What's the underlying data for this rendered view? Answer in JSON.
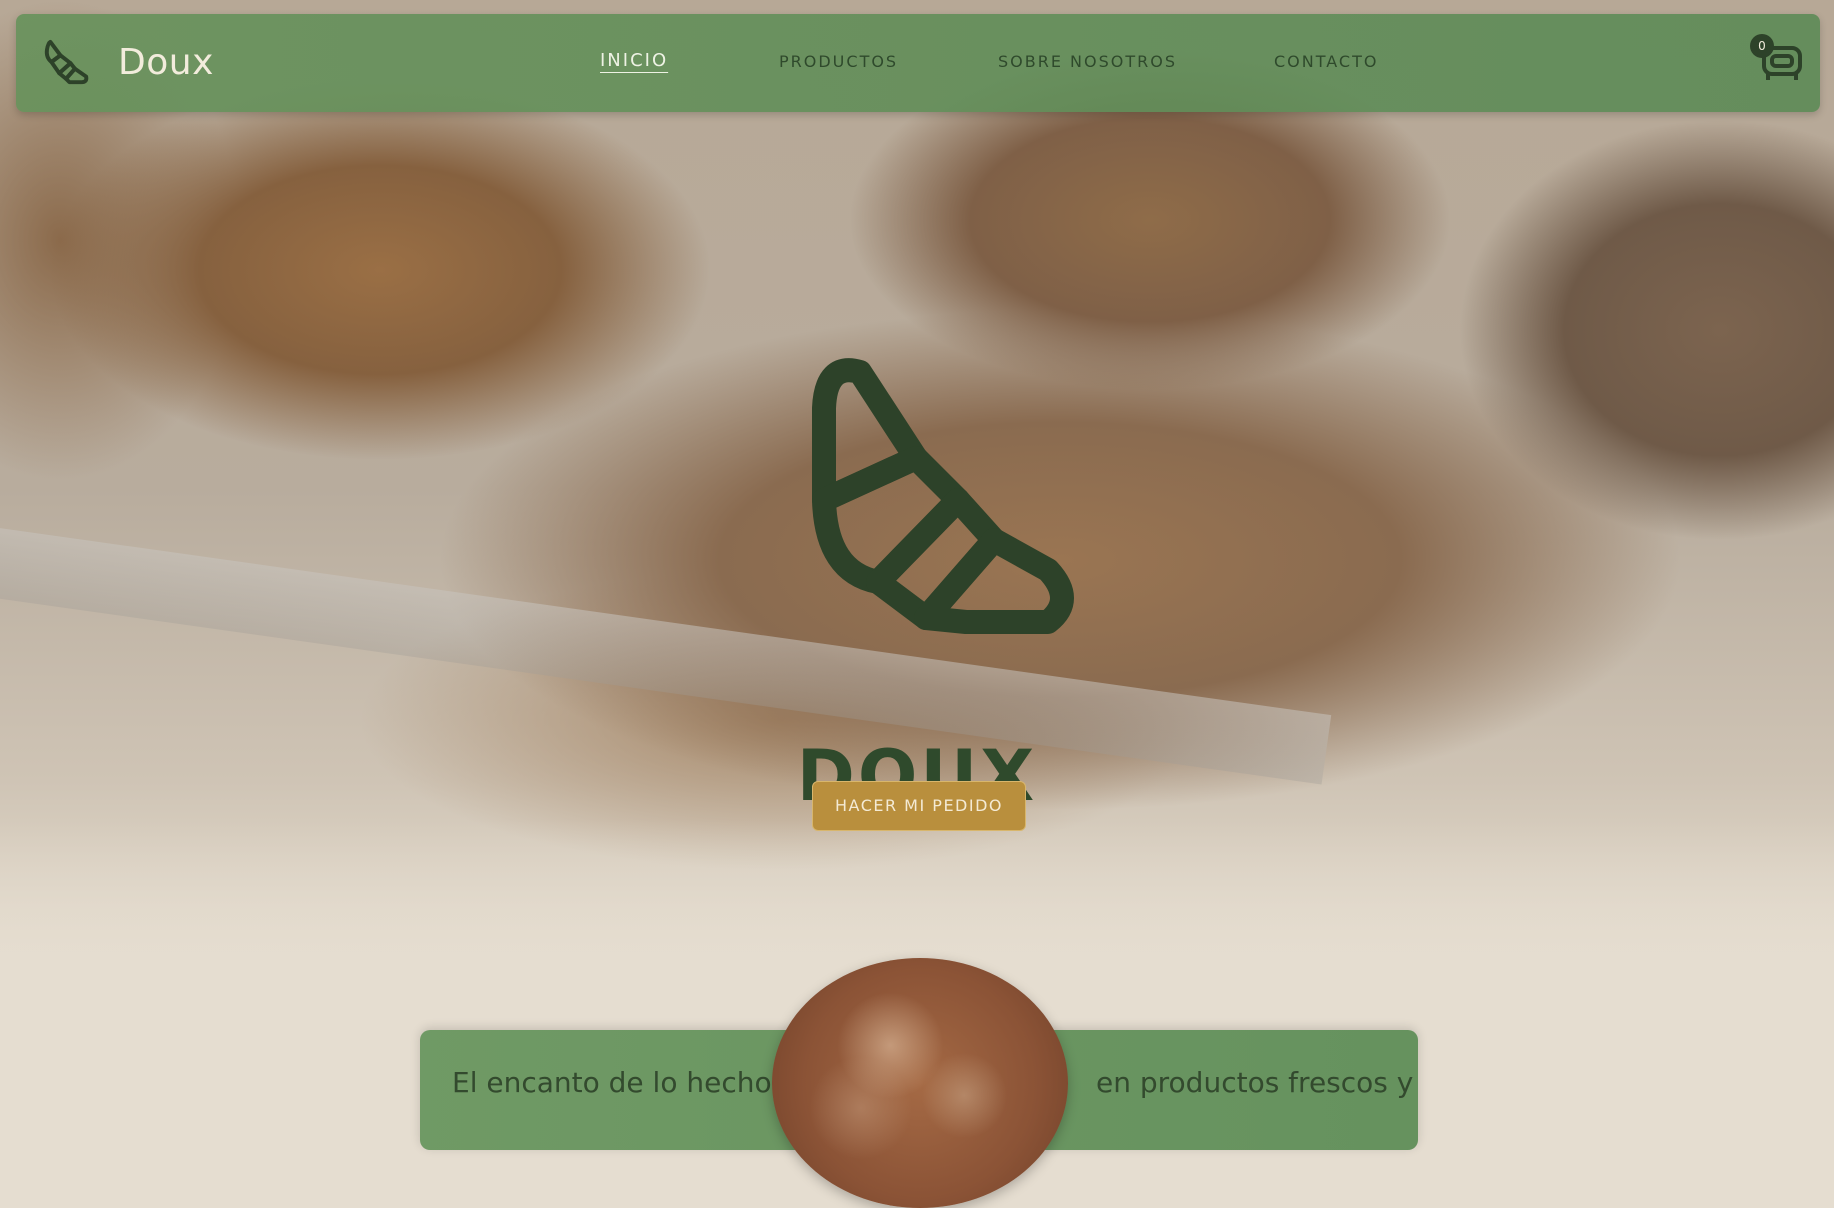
{
  "brand": {
    "name": "Doux"
  },
  "nav": {
    "items": [
      {
        "label": "INICIO",
        "active": true
      },
      {
        "label": "PRODUCTOS",
        "active": false
      },
      {
        "label": "SOBRE NOSOTROS",
        "active": false
      },
      {
        "label": "CONTACTO",
        "active": false
      }
    ]
  },
  "cart": {
    "count": "0",
    "icon": "cart-icon"
  },
  "hero": {
    "title": "DOUX",
    "cta_label": "HACER MI PEDIDO",
    "logo_icon": "croissant-icon"
  },
  "intro": {
    "left_text": "El encanto de lo hecho",
    "right_text": "en productos frescos y"
  },
  "colors": {
    "nav_green": "#5f8e57",
    "dark_green": "#2f4a2c",
    "accent_gold": "#b98f3d",
    "cream": "#f2ecdc"
  }
}
